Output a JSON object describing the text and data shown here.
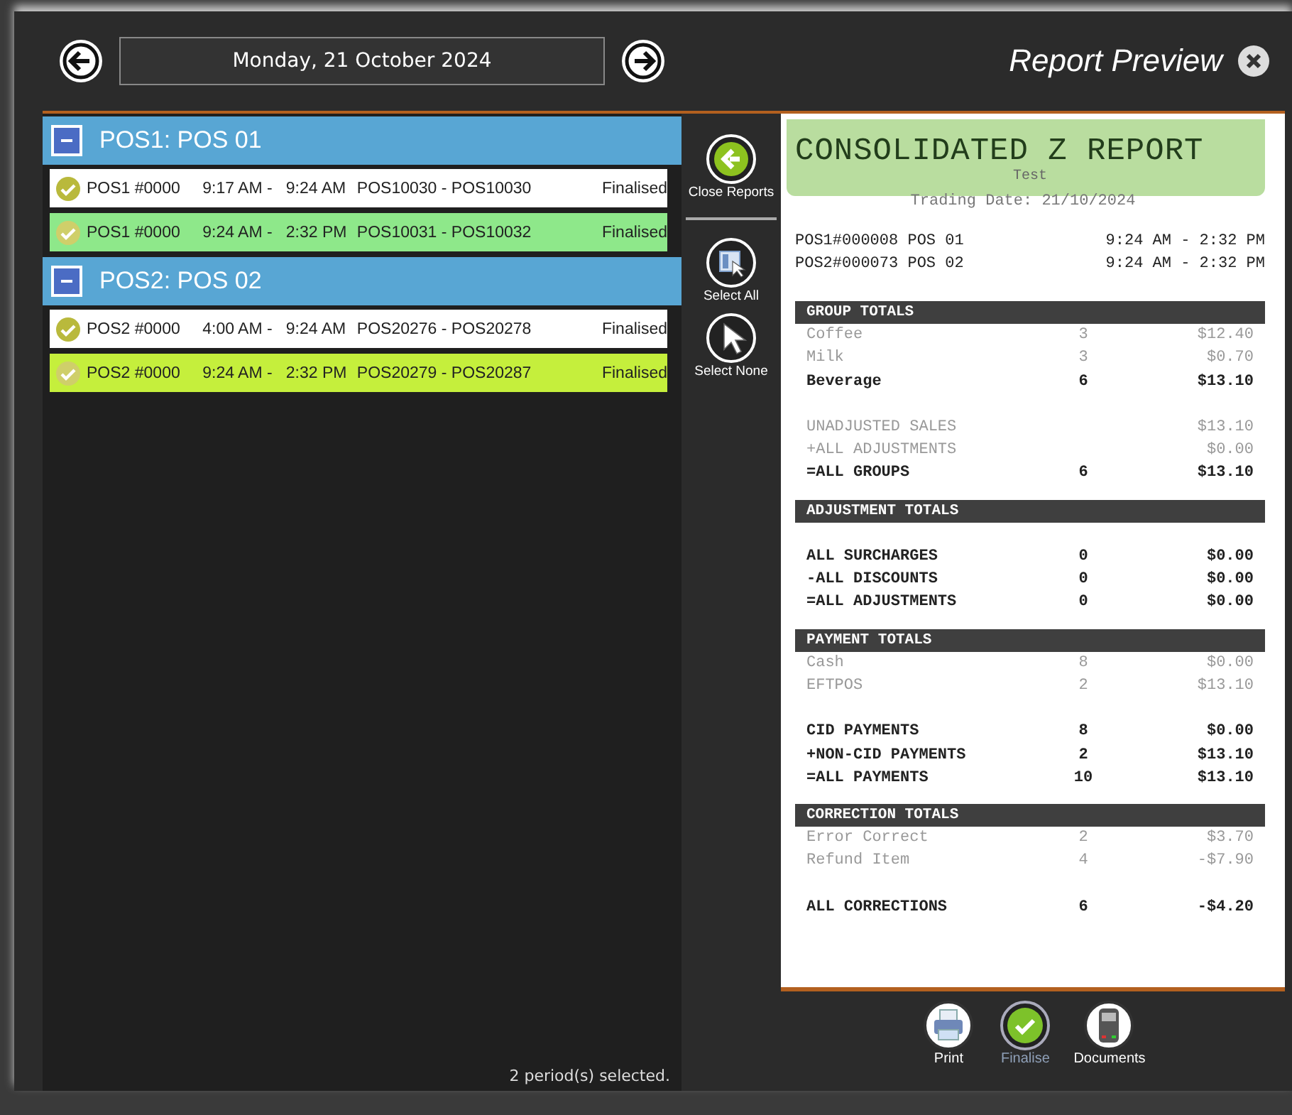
{
  "header": {
    "date": "Monday, 21 October 2024",
    "title": "Report Preview"
  },
  "groups": [
    {
      "title": "POS1: POS 01",
      "expanded": true,
      "rows": [
        {
          "till": "POS1 #0000",
          "time": "9:17 AM -   9:24 AM",
          "range": "POS10030 - POS10030",
          "status": "Finalised",
          "selected": false,
          "color": "#ffffff"
        },
        {
          "till": "POS1 #0000",
          "time": "9:24 AM -   2:32 PM",
          "range": "POS10031 - POS10032",
          "status": "Finalised",
          "selected": true,
          "color": "#8ee88a"
        }
      ]
    },
    {
      "title": "POS2: POS 02",
      "expanded": true,
      "rows": [
        {
          "till": "POS2 #0000",
          "time": "4:00 AM -   9:24 AM",
          "range": "POS20276 - POS20278",
          "status": "Finalised",
          "selected": false,
          "color": "#ffffff"
        },
        {
          "till": "POS2 #0000",
          "time": "9:24 AM -   2:32 PM",
          "range": "POS20279 - POS20287",
          "status": "Finalised",
          "selected": true,
          "color": "#c5ef3c"
        }
      ]
    }
  ],
  "status_text": "2 period(s) selected.",
  "side_tools": [
    {
      "kind": "close",
      "label": "Close Reports"
    },
    {
      "kind": "select_all",
      "label": "Select All"
    },
    {
      "kind": "select_none",
      "label": "Select None"
    }
  ],
  "report": {
    "title": "CONSOLIDATED Z REPORT",
    "subtitle": "Test",
    "trading_date": "Trading Date: 21/10/2024",
    "periods": [
      {
        "name": "POS1#000008 POS 01",
        "time": "9:24 AM -  2:32 PM"
      },
      {
        "name": "POS2#000073 POS 02",
        "time": "9:24 AM -  2:32 PM"
      }
    ],
    "sections": [
      {
        "heading": "GROUP TOTALS",
        "lines": [
          {
            "label": "Coffee",
            "count": "3",
            "amount": "$12.40",
            "bold": false,
            "gap_before": false
          },
          {
            "label": "Milk",
            "count": "3",
            "amount": "$0.70",
            "bold": false,
            "gap_before": false
          },
          {
            "label": "Beverage",
            "count": "6",
            "amount": "$13.10",
            "bold": true,
            "gap_before": false
          },
          {
            "label": "UNADJUSTED SALES",
            "amount": "$13.10",
            "bold": false,
            "gap_before": true
          },
          {
            "label": "+ALL ADJUSTMENTS",
            "amount": "$0.00",
            "bold": false,
            "gap_before": false
          },
          {
            "label": "=ALL GROUPS",
            "count": "6",
            "amount": "$13.10",
            "bold": true,
            "gap_before": false
          }
        ]
      },
      {
        "heading": "ADJUSTMENT TOTALS",
        "lines": [
          {
            "label": "ALL SURCHARGES",
            "count": "0",
            "amount": "$0.00",
            "bold": true,
            "gap_before": true
          },
          {
            "label": "-ALL DISCOUNTS",
            "count": "0",
            "amount": "$0.00",
            "bold": true,
            "gap_before": false
          },
          {
            "label": "=ALL ADJUSTMENTS",
            "count": "0",
            "amount": "$0.00",
            "bold": true,
            "gap_before": false
          }
        ]
      },
      {
        "heading": "PAYMENT TOTALS",
        "lines": [
          {
            "label": "Cash",
            "count": "8",
            "amount": "$0.00",
            "bold": false,
            "gap_before": false
          },
          {
            "label": "EFTPOS",
            "count": "2",
            "amount": "$13.10",
            "bold": false,
            "gap_before": false
          },
          {
            "label": "CID PAYMENTS",
            "count": "8",
            "amount": "$0.00",
            "bold": true,
            "gap_before": true
          },
          {
            "label": "+NON-CID PAYMENTS",
            "count": "2",
            "amount": "$13.10",
            "bold": true,
            "gap_before": false
          },
          {
            "label": "=ALL PAYMENTS",
            "count": "10",
            "amount": "$13.10",
            "bold": true,
            "gap_before": false
          }
        ]
      },
      {
        "heading": "CORRECTION TOTALS",
        "lines": [
          {
            "label": "Error Correct",
            "count": "2",
            "amount": "$3.70",
            "bold": false,
            "gap_before": false
          },
          {
            "label": "Refund Item",
            "count": "4",
            "amount": "-$7.90",
            "bold": false,
            "gap_before": false
          },
          {
            "label": "ALL CORRECTIONS",
            "count": "6",
            "amount": "-$4.20",
            "bold": true,
            "gap_before": true
          }
        ]
      }
    ]
  },
  "actions": [
    {
      "kind": "print",
      "label": "Print",
      "disabled": false
    },
    {
      "kind": "finalise",
      "label": "Finalise",
      "disabled": true
    },
    {
      "kind": "documents",
      "label": "Documents",
      "disabled": false
    }
  ]
}
